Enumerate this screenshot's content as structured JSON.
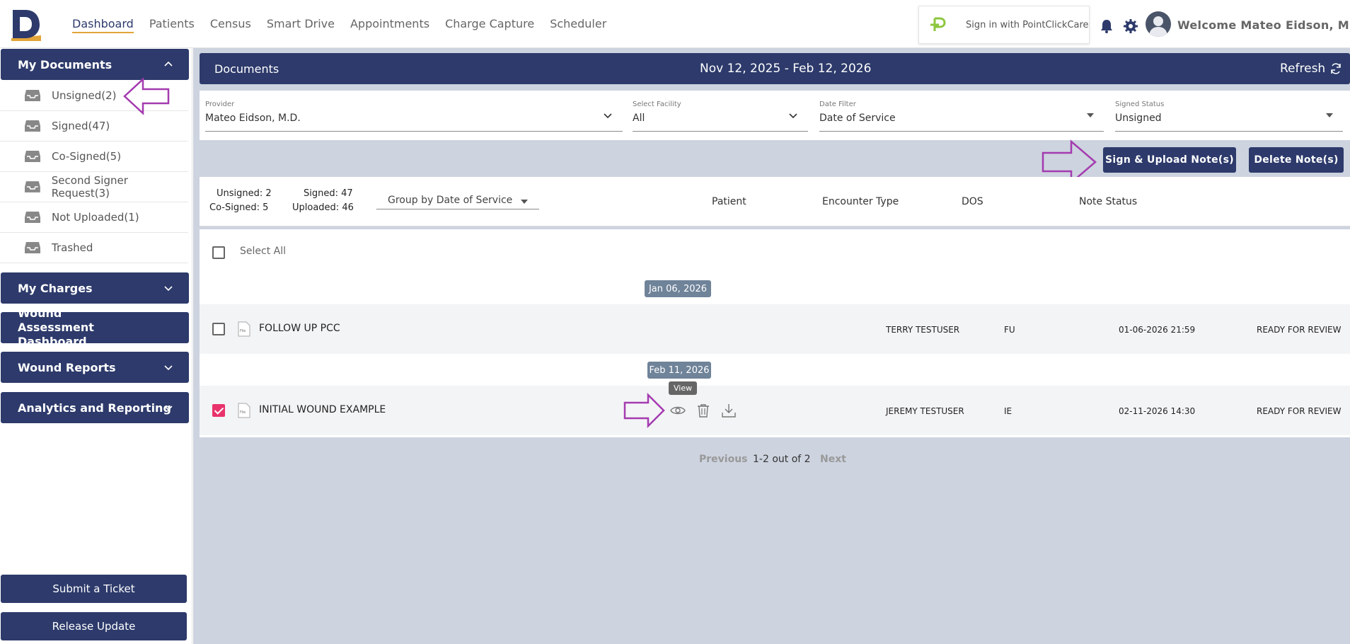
{
  "nav": {
    "items": [
      "Dashboard",
      "Patients",
      "Census",
      "Smart Drive",
      "Appointments",
      "Charge Capture",
      "Scheduler"
    ],
    "active": "Dashboard"
  },
  "header": {
    "pcc_label": "Sign in with PointClickCare",
    "welcome": "Welcome Mateo Eidson, M.D."
  },
  "sidebar": {
    "my_documents": "My Documents",
    "items": [
      {
        "label": "Unsigned(2)"
      },
      {
        "label": "Signed(47)"
      },
      {
        "label": "Co-Signed(5)"
      },
      {
        "label": "Second Signer Request(3)"
      },
      {
        "label": "Not Uploaded(1)"
      },
      {
        "label": "Trashed"
      }
    ],
    "sections": [
      "My Charges",
      "Wound Assessment Dashboard",
      "Wound Reports",
      "Analytics and Reporting"
    ],
    "submit_ticket": "Submit a Ticket",
    "release_update": "Release Update"
  },
  "documents": {
    "title": "Documents",
    "date_range": "Nov 12, 2025 - Feb 12, 2026",
    "refresh": "Refresh"
  },
  "filters": {
    "provider": {
      "label": "Provider",
      "value": "Mateo Eidson, M.D."
    },
    "facility": {
      "label": "Select Facility",
      "value": "All"
    },
    "date_filter": {
      "label": "Date Filter",
      "value": "Date of Service"
    },
    "signed_status": {
      "label": "Signed Status",
      "value": "Unsigned"
    }
  },
  "actions": {
    "sign_upload": "Sign & Upload Note(s)",
    "delete": "Delete Note(s)"
  },
  "summary": {
    "unsigned": "Unsigned: 2",
    "signed": "Signed: 47",
    "cosigned": "Co-Signed: 5",
    "uploaded": "Uploaded: 46",
    "group_by": "Group by Date of Service"
  },
  "columns": {
    "patient": "Patient",
    "encounter_type": "Encounter Type",
    "dos": "DOS",
    "note_status": "Note Status"
  },
  "list": {
    "select_all": "Select All",
    "file_tag": "File",
    "groups": [
      {
        "date": "Jan 06, 2026",
        "row": {
          "name": "FOLLOW UP PCC",
          "patient": "TERRY TESTUSER",
          "encounter": "FU",
          "dos": "01-06-2026 21:59",
          "status": "READY FOR REVIEW",
          "checked": false
        }
      },
      {
        "date": "Feb 11, 2026",
        "row": {
          "name": "INITIAL WOUND EXAMPLE",
          "patient": "JEREMY TESTUSER",
          "encounter": "IE",
          "dos": "02-11-2026 14:30",
          "status": "READY FOR REVIEW",
          "checked": true
        }
      }
    ],
    "tooltip": "View"
  },
  "pager": {
    "previous": "Previous",
    "info": "1-2 out of 2",
    "next": "Next"
  },
  "colors": {
    "navy": "#2d3a6b",
    "accent": "#e2a53a",
    "annotation": "#a43bb0",
    "checked": "#e8336b"
  }
}
